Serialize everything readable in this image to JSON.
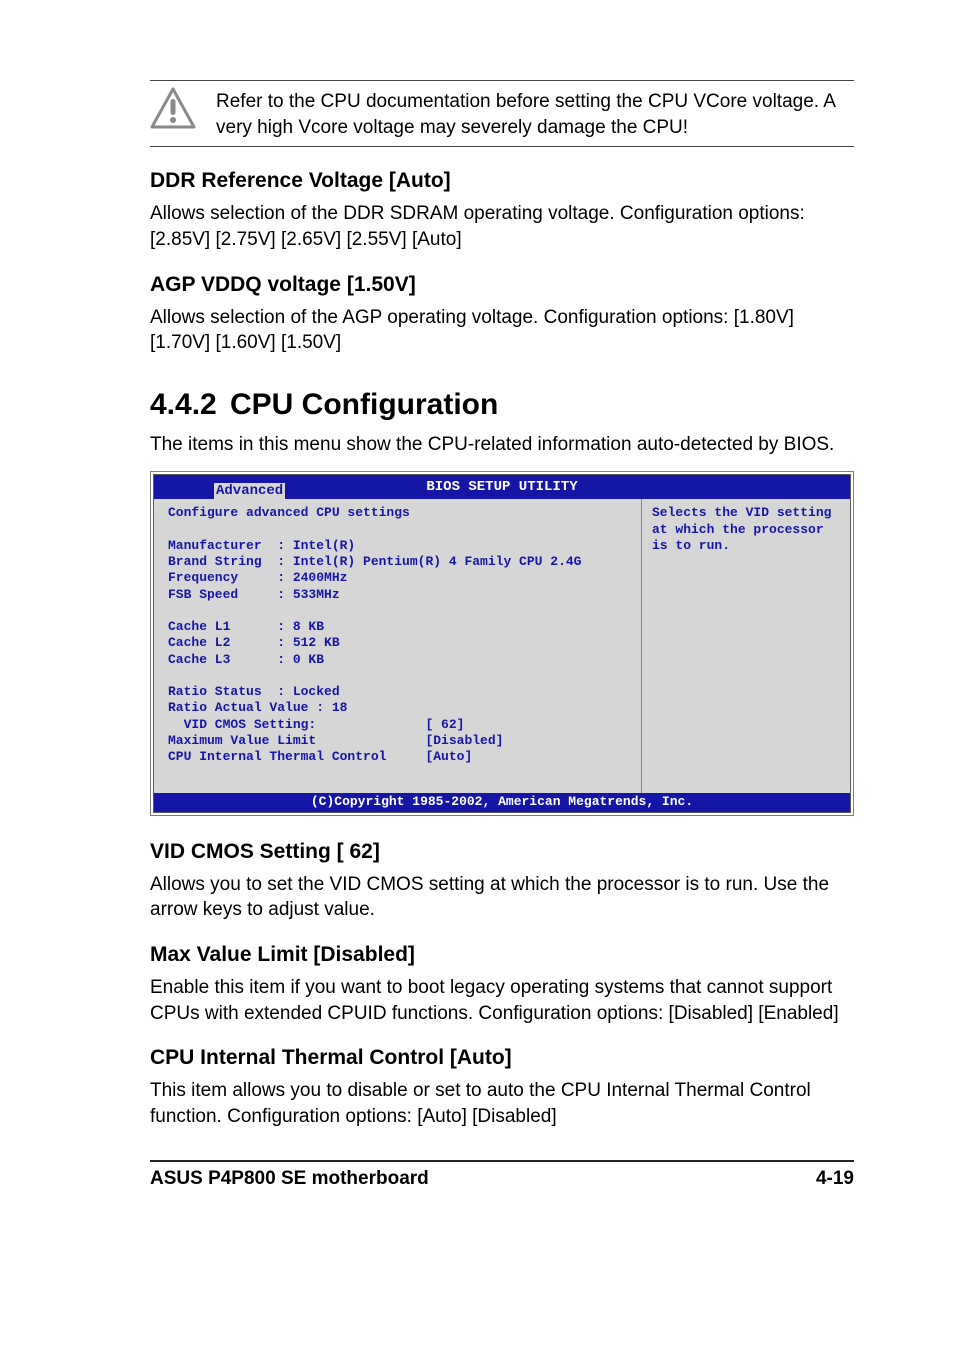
{
  "warning": {
    "text": "Refer to the CPU documentation before setting the CPU VCore voltage. A very high Vcore voltage may severely damage the CPU!"
  },
  "sections": {
    "ddr": {
      "heading": "DDR Reference Voltage [Auto]",
      "body": "Allows selection of the DDR SDRAM operating voltage. Configuration options: [2.85V] [2.75V] [2.65V] [2.55V] [Auto]"
    },
    "agp": {
      "heading": "AGP VDDQ voltage [1.50V]",
      "body": "Allows selection of the AGP operating voltage. Configuration options: [1.80V] [1.70V] [1.60V] [1.50V]"
    },
    "cpu_cfg": {
      "number": "4.4.2",
      "heading": "CPU Configuration",
      "intro": "The items in this menu show the CPU-related information auto-detected by BIOS."
    },
    "vid": {
      "heading": "VID CMOS Setting [ 62]",
      "body": "Allows you to set the VID CMOS setting at which the processor is to run. Use the arrow keys to adjust value."
    },
    "maxval": {
      "heading": "Max Value Limit [Disabled]",
      "body": "Enable this item if you want to boot legacy operating systems that cannot support CPUs with extended CPUID functions. Configuration options: [Disabled] [Enabled]"
    },
    "citc": {
      "heading": "CPU Internal Thermal Control [Auto]",
      "body": "This item allows you to disable or set to auto the CPU Internal Thermal Control function. Configuration options: [Auto] [Disabled]"
    }
  },
  "bios": {
    "title": "BIOS SETUP UTILITY",
    "tab": "Advanced",
    "left_top": "Configure advanced CPU settings",
    "info": "Manufacturer  : Intel(R)\nBrand String  : Intel(R) Pentium(R) 4 Family CPU 2.4G\nFrequency     : 2400MHz\nFSB Speed     : 533MHz\n\nCache L1      : 8 KB\nCache L2      : 512 KB\nCache L3      : 0 KB\n\nRatio Status  : Locked\nRatio Actual Value : 18\n  VID CMOS Setting:              [ 62]\nMaximum Value Limit              [Disabled]\nCPU Internal Thermal Control     [Auto]",
    "help": "Selects the VID setting at which the processor is to run.",
    "footer": "(C)Copyright 1985-2002, American Megatrends, Inc."
  },
  "footer": {
    "left": "ASUS P4P800 SE motherboard",
    "right": "4-19"
  }
}
